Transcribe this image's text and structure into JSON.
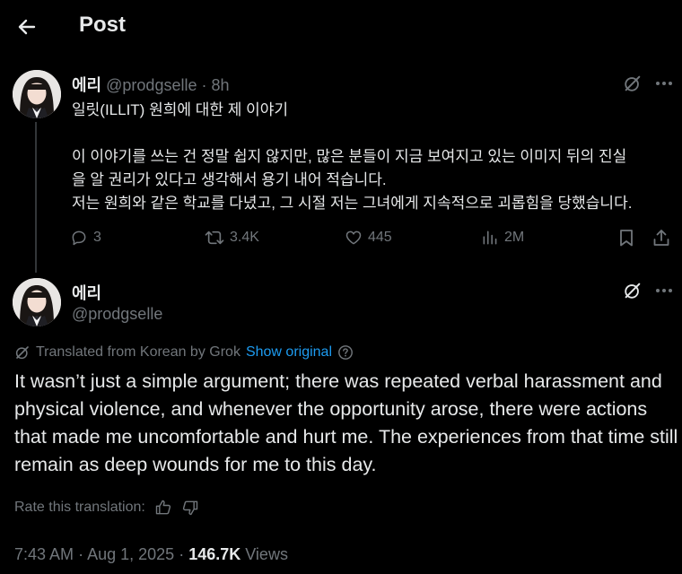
{
  "header": {
    "title": "Post"
  },
  "tweet1": {
    "name": "에리",
    "handle": "@prodgselle",
    "time": "8h",
    "lines": [
      "일릿(ILLIT) 원희에 대한 제 이야기",
      "",
      "이 이야기를 쓰는 건 정말 쉽지 않지만, 많은 분들이 지금 보여지고 있는 이미지 뒤의 진실",
      "을 알 권리가 있다고 생각해서 용기 내어 적습니다.",
      "저는 원희와 같은 학교를 다녔고, 그 시절 저는 그녀에게 지속적으로 괴롭힘을 당했습니다."
    ],
    "actions": {
      "replies": "3",
      "reposts": "3.4K",
      "likes": "445",
      "views": "2M"
    }
  },
  "tweet2": {
    "name": "에리",
    "handle": "@prodgselle",
    "translated_label": "Translated from Korean by Grok",
    "show_original": "Show original",
    "body": "It wasn’t just a simple argument; there was repeated verbal harassment and physical violence, and whenever the opportunity arose, there were actions that made me uncomfortable and hurt me. The experiences from that time still remain as deep wounds for me to this day.",
    "rate_label": "Rate this translation:",
    "time": "7:43 AM",
    "date": "Aug 1, 2025",
    "views": "146.7K",
    "views_label": "Views"
  },
  "colors": {
    "background": "#000000",
    "text": "#e7e9ea",
    "muted": "#71767b",
    "link": "#1d9bf0"
  },
  "icons": [
    "back-arrow-icon",
    "grok-icon",
    "more-icon",
    "reply-icon",
    "repost-icon",
    "like-icon",
    "views-icon",
    "bookmark-icon",
    "share-icon",
    "info-icon",
    "thumbs-up-icon",
    "thumbs-down-icon"
  ]
}
